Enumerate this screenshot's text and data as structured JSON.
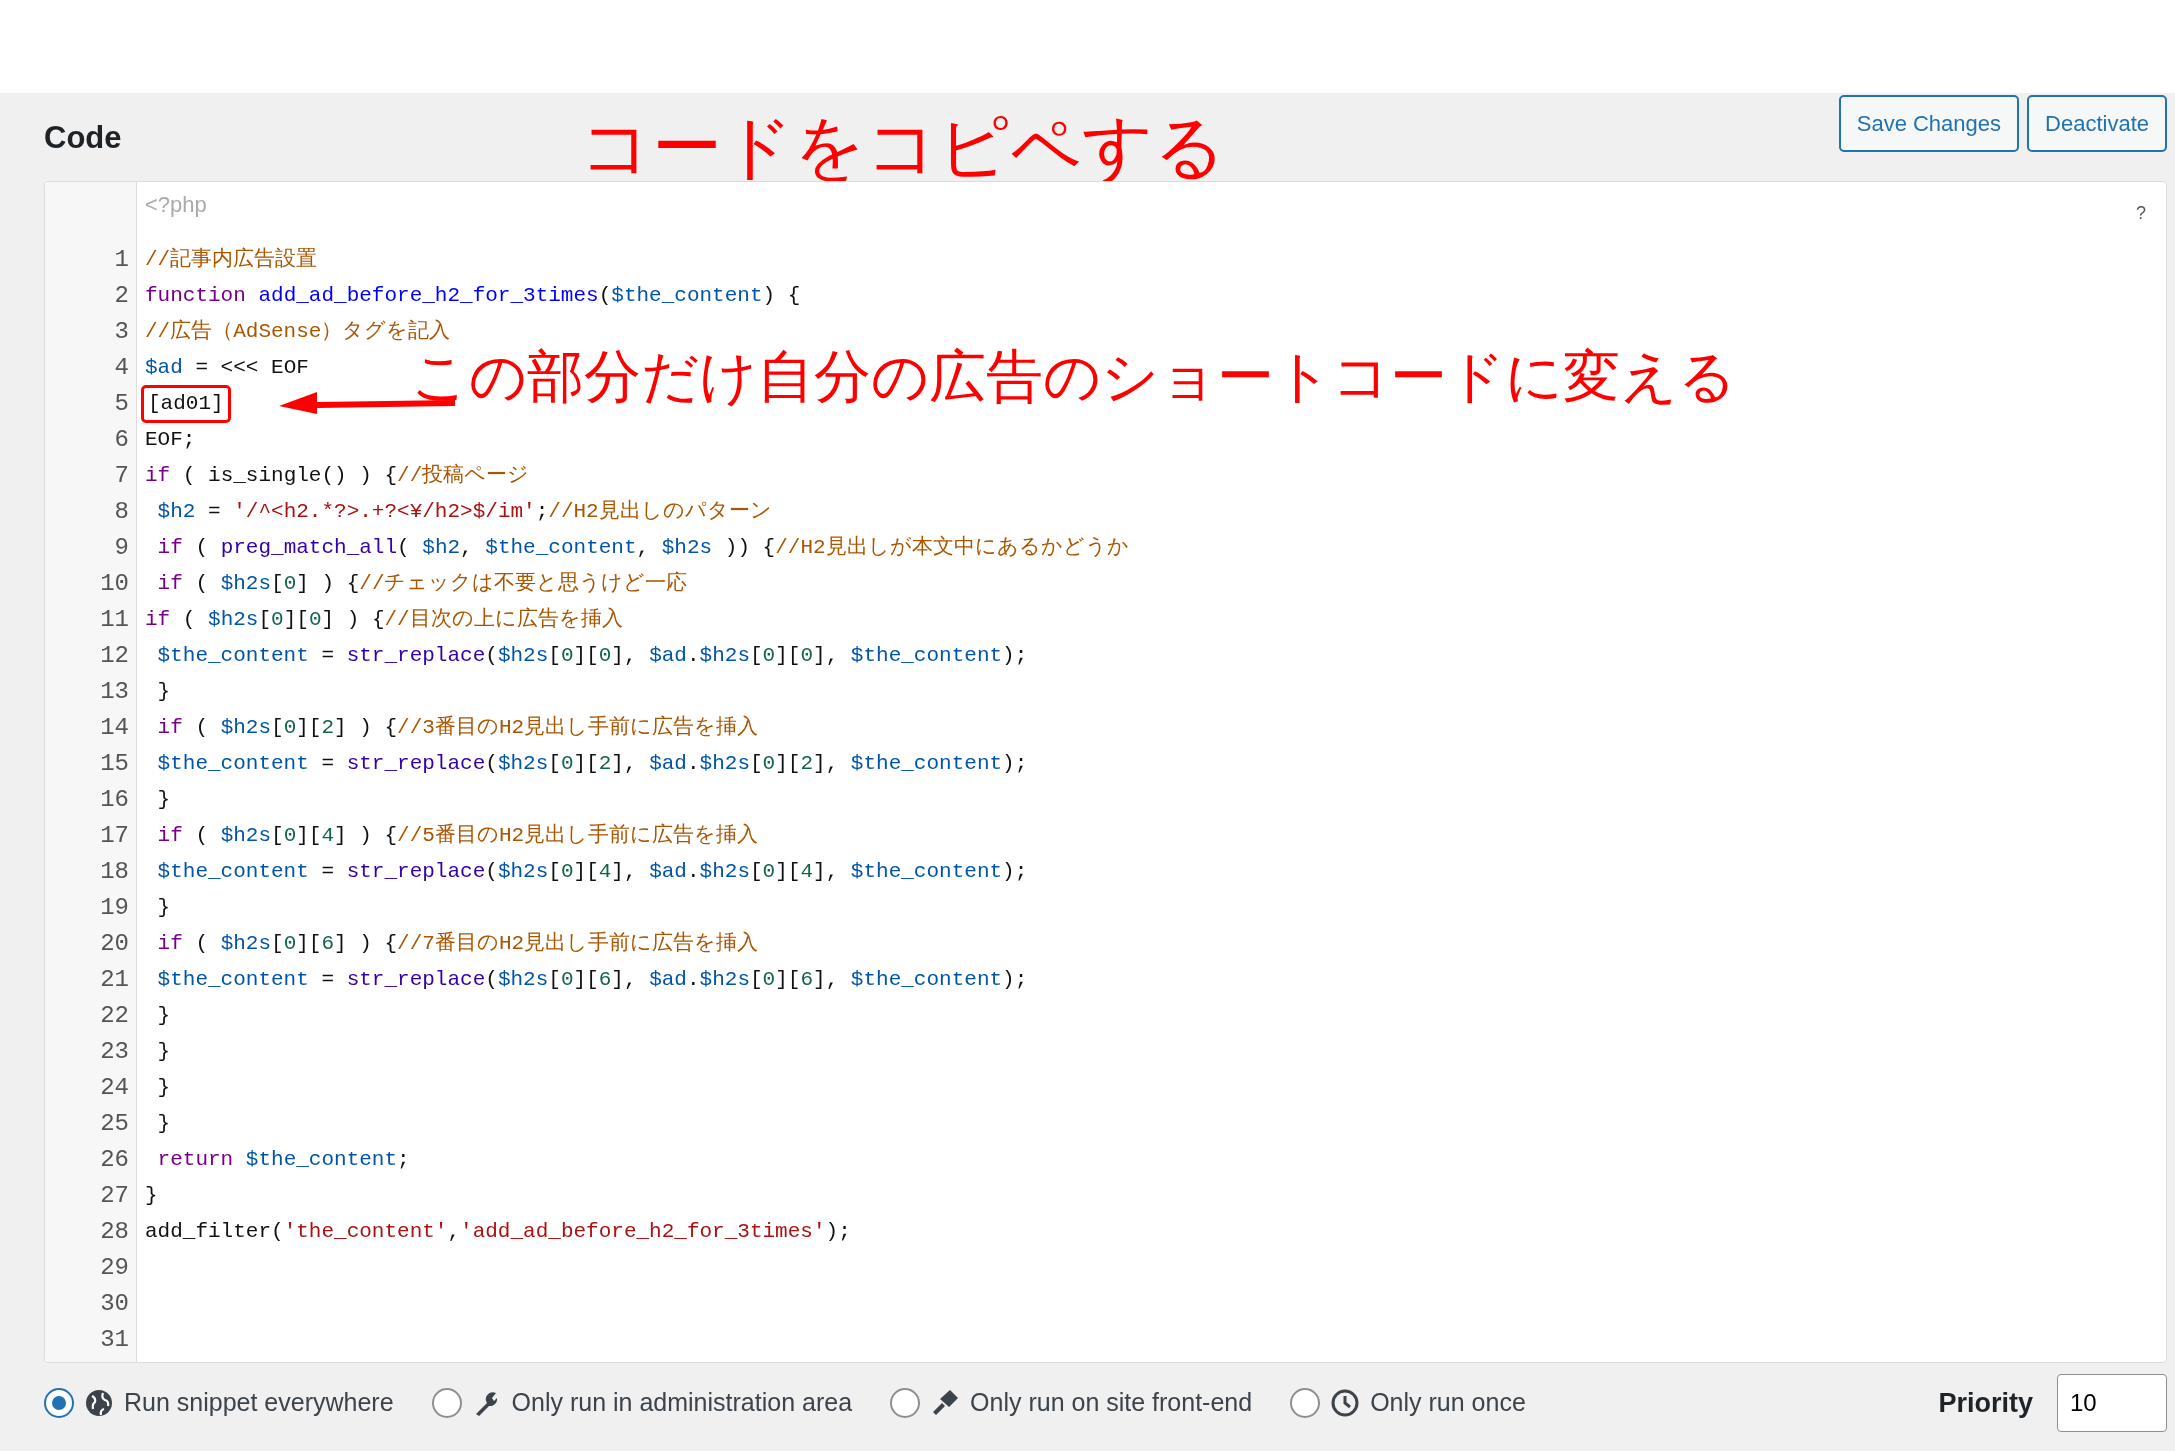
{
  "section_title": "Code",
  "buttons": [
    "Save Changes",
    "Deactivate"
  ],
  "annotations": [
    {
      "kind": "title",
      "text": "コードをコピペする"
    },
    {
      "kind": "callout",
      "text": "この部分だけ自分の広告のショートコードに変える"
    }
  ],
  "editor": {
    "opening_tag": "<?php",
    "help": "?",
    "lines": [
      {
        "number": "1",
        "highlighted": false,
        "tokens": [
          {
            "kind": "comment",
            "text": "//記事内広告設置"
          }
        ]
      },
      {
        "number": "2",
        "highlighted": false,
        "tokens": [
          {
            "kind": "keyword",
            "text": "function "
          },
          {
            "kind": "def",
            "text": "add_ad_before_h2_for_3times"
          },
          {
            "kind": "plain",
            "text": "("
          },
          {
            "kind": "variable",
            "text": "$the_content"
          },
          {
            "kind": "plain",
            "text": ") {"
          }
        ]
      },
      {
        "number": "3",
        "highlighted": false,
        "tokens": [
          {
            "kind": "comment",
            "text": "//広告（AdSense）タグを記入"
          }
        ]
      },
      {
        "number": "4",
        "highlighted": false,
        "tokens": [
          {
            "kind": "variable",
            "text": "$ad"
          },
          {
            "kind": "plain",
            "text": " = <<< EOF"
          }
        ]
      },
      {
        "number": "5",
        "highlighted": true,
        "tokens": [
          {
            "kind": "plain",
            "text": "[ad01]"
          }
        ]
      },
      {
        "number": "6",
        "highlighted": false,
        "tokens": [
          {
            "kind": "plain",
            "text": "EOF;"
          }
        ]
      },
      {
        "number": "7",
        "highlighted": false,
        "tokens": [
          {
            "kind": "keyword",
            "text": "if"
          },
          {
            "kind": "plain",
            "text": " ( is_single() ) {"
          },
          {
            "kind": "comment",
            "text": "//投稿ページ"
          }
        ]
      },
      {
        "number": "8",
        "highlighted": false,
        "tokens": [
          {
            "kind": "variable",
            "text": " $h2"
          },
          {
            "kind": "plain",
            "text": " = "
          },
          {
            "kind": "string",
            "text": "'/^<h2.*?>.+?<¥/h2>$/im'"
          },
          {
            "kind": "plain",
            "text": ";"
          },
          {
            "kind": "comment",
            "text": "//H2見出しのパターン"
          }
        ]
      },
      {
        "number": "9",
        "highlighted": false,
        "tokens": [
          {
            "kind": "keyword",
            "text": " if"
          },
          {
            "kind": "plain",
            "text": " ( "
          },
          {
            "kind": "builtin",
            "text": "preg_match_all"
          },
          {
            "kind": "plain",
            "text": "( "
          },
          {
            "kind": "variable",
            "text": "$h2"
          },
          {
            "kind": "plain",
            "text": ", "
          },
          {
            "kind": "variable",
            "text": "$the_content"
          },
          {
            "kind": "plain",
            "text": ", "
          },
          {
            "kind": "variable",
            "text": "$h2s"
          },
          {
            "kind": "plain",
            "text": " )) {"
          },
          {
            "kind": "comment",
            "text": "//H2見出しが本文中にあるかどうか"
          }
        ]
      },
      {
        "number": "10",
        "highlighted": false,
        "tokens": [
          {
            "kind": "keyword",
            "text": " if"
          },
          {
            "kind": "plain",
            "text": " ( "
          },
          {
            "kind": "variable",
            "text": "$h2s"
          },
          {
            "kind": "plain",
            "text": "["
          },
          {
            "kind": "number",
            "text": "0"
          },
          {
            "kind": "plain",
            "text": "] ) {"
          },
          {
            "kind": "comment",
            "text": "//チェックは不要と思うけど一応"
          }
        ]
      },
      {
        "number": "11",
        "highlighted": false,
        "tokens": [
          {
            "kind": "keyword",
            "text": "if"
          },
          {
            "kind": "plain",
            "text": " ( "
          },
          {
            "kind": "variable",
            "text": "$h2s"
          },
          {
            "kind": "plain",
            "text": "["
          },
          {
            "kind": "number",
            "text": "0"
          },
          {
            "kind": "plain",
            "text": "]["
          },
          {
            "kind": "number",
            "text": "0"
          },
          {
            "kind": "plain",
            "text": "] ) {"
          },
          {
            "kind": "comment",
            "text": "//目次の上に広告を挿入"
          }
        ]
      },
      {
        "number": "12",
        "highlighted": false,
        "tokens": [
          {
            "kind": "variable",
            "text": " $the_content"
          },
          {
            "kind": "plain",
            "text": " = "
          },
          {
            "kind": "builtin",
            "text": "str_replace"
          },
          {
            "kind": "plain",
            "text": "("
          },
          {
            "kind": "variable",
            "text": "$h2s"
          },
          {
            "kind": "plain",
            "text": "["
          },
          {
            "kind": "number",
            "text": "0"
          },
          {
            "kind": "plain",
            "text": "]["
          },
          {
            "kind": "number",
            "text": "0"
          },
          {
            "kind": "plain",
            "text": "], "
          },
          {
            "kind": "variable",
            "text": "$ad"
          },
          {
            "kind": "plain",
            "text": "."
          },
          {
            "kind": "variable",
            "text": "$h2s"
          },
          {
            "kind": "plain",
            "text": "["
          },
          {
            "kind": "number",
            "text": "0"
          },
          {
            "kind": "plain",
            "text": "]["
          },
          {
            "kind": "number",
            "text": "0"
          },
          {
            "kind": "plain",
            "text": "], "
          },
          {
            "kind": "variable",
            "text": "$the_content"
          },
          {
            "kind": "plain",
            "text": ");"
          }
        ]
      },
      {
        "number": "13",
        "highlighted": false,
        "tokens": [
          {
            "kind": "plain",
            "text": " }"
          }
        ]
      },
      {
        "number": "14",
        "highlighted": false,
        "tokens": [
          {
            "kind": "keyword",
            "text": " if"
          },
          {
            "kind": "plain",
            "text": " ( "
          },
          {
            "kind": "variable",
            "text": "$h2s"
          },
          {
            "kind": "plain",
            "text": "["
          },
          {
            "kind": "number",
            "text": "0"
          },
          {
            "kind": "plain",
            "text": "]["
          },
          {
            "kind": "number",
            "text": "2"
          },
          {
            "kind": "plain",
            "text": "] ) {"
          },
          {
            "kind": "comment",
            "text": "//3番目のH2見出し手前に広告を挿入"
          }
        ]
      },
      {
        "number": "15",
        "highlighted": false,
        "tokens": [
          {
            "kind": "variable",
            "text": " $the_content"
          },
          {
            "kind": "plain",
            "text": " = "
          },
          {
            "kind": "builtin",
            "text": "str_replace"
          },
          {
            "kind": "plain",
            "text": "("
          },
          {
            "kind": "variable",
            "text": "$h2s"
          },
          {
            "kind": "plain",
            "text": "["
          },
          {
            "kind": "number",
            "text": "0"
          },
          {
            "kind": "plain",
            "text": "]["
          },
          {
            "kind": "number",
            "text": "2"
          },
          {
            "kind": "plain",
            "text": "], "
          },
          {
            "kind": "variable",
            "text": "$ad"
          },
          {
            "kind": "plain",
            "text": "."
          },
          {
            "kind": "variable",
            "text": "$h2s"
          },
          {
            "kind": "plain",
            "text": "["
          },
          {
            "kind": "number",
            "text": "0"
          },
          {
            "kind": "plain",
            "text": "]["
          },
          {
            "kind": "number",
            "text": "2"
          },
          {
            "kind": "plain",
            "text": "], "
          },
          {
            "kind": "variable",
            "text": "$the_content"
          },
          {
            "kind": "plain",
            "text": ");"
          }
        ]
      },
      {
        "number": "16",
        "highlighted": false,
        "tokens": [
          {
            "kind": "plain",
            "text": " }"
          }
        ]
      },
      {
        "number": "17",
        "highlighted": false,
        "tokens": [
          {
            "kind": "keyword",
            "text": " if"
          },
          {
            "kind": "plain",
            "text": " ( "
          },
          {
            "kind": "variable",
            "text": "$h2s"
          },
          {
            "kind": "plain",
            "text": "["
          },
          {
            "kind": "number",
            "text": "0"
          },
          {
            "kind": "plain",
            "text": "]["
          },
          {
            "kind": "number",
            "text": "4"
          },
          {
            "kind": "plain",
            "text": "] ) {"
          },
          {
            "kind": "comment",
            "text": "//5番目のH2見出し手前に広告を挿入"
          }
        ]
      },
      {
        "number": "18",
        "highlighted": false,
        "tokens": [
          {
            "kind": "variable",
            "text": " $the_content"
          },
          {
            "kind": "plain",
            "text": " = "
          },
          {
            "kind": "builtin",
            "text": "str_replace"
          },
          {
            "kind": "plain",
            "text": "("
          },
          {
            "kind": "variable",
            "text": "$h2s"
          },
          {
            "kind": "plain",
            "text": "["
          },
          {
            "kind": "number",
            "text": "0"
          },
          {
            "kind": "plain",
            "text": "]["
          },
          {
            "kind": "number",
            "text": "4"
          },
          {
            "kind": "plain",
            "text": "], "
          },
          {
            "kind": "variable",
            "text": "$ad"
          },
          {
            "kind": "plain",
            "text": "."
          },
          {
            "kind": "variable",
            "text": "$h2s"
          },
          {
            "kind": "plain",
            "text": "["
          },
          {
            "kind": "number",
            "text": "0"
          },
          {
            "kind": "plain",
            "text": "]["
          },
          {
            "kind": "number",
            "text": "4"
          },
          {
            "kind": "plain",
            "text": "], "
          },
          {
            "kind": "variable",
            "text": "$the_content"
          },
          {
            "kind": "plain",
            "text": ");"
          }
        ]
      },
      {
        "number": "19",
        "highlighted": false,
        "tokens": [
          {
            "kind": "plain",
            "text": " }"
          }
        ]
      },
      {
        "number": "20",
        "highlighted": false,
        "tokens": [
          {
            "kind": "keyword",
            "text": " if"
          },
          {
            "kind": "plain",
            "text": " ( "
          },
          {
            "kind": "variable",
            "text": "$h2s"
          },
          {
            "kind": "plain",
            "text": "["
          },
          {
            "kind": "number",
            "text": "0"
          },
          {
            "kind": "plain",
            "text": "]["
          },
          {
            "kind": "number",
            "text": "6"
          },
          {
            "kind": "plain",
            "text": "] ) {"
          },
          {
            "kind": "comment",
            "text": "//7番目のH2見出し手前に広告を挿入"
          }
        ]
      },
      {
        "number": "21",
        "highlighted": false,
        "tokens": [
          {
            "kind": "variable",
            "text": " $the_content"
          },
          {
            "kind": "plain",
            "text": " = "
          },
          {
            "kind": "builtin",
            "text": "str_replace"
          },
          {
            "kind": "plain",
            "text": "("
          },
          {
            "kind": "variable",
            "text": "$h2s"
          },
          {
            "kind": "plain",
            "text": "["
          },
          {
            "kind": "number",
            "text": "0"
          },
          {
            "kind": "plain",
            "text": "]["
          },
          {
            "kind": "number",
            "text": "6"
          },
          {
            "kind": "plain",
            "text": "], "
          },
          {
            "kind": "variable",
            "text": "$ad"
          },
          {
            "kind": "plain",
            "text": "."
          },
          {
            "kind": "variable",
            "text": "$h2s"
          },
          {
            "kind": "plain",
            "text": "["
          },
          {
            "kind": "number",
            "text": "0"
          },
          {
            "kind": "plain",
            "text": "]["
          },
          {
            "kind": "number",
            "text": "6"
          },
          {
            "kind": "plain",
            "text": "], "
          },
          {
            "kind": "variable",
            "text": "$the_content"
          },
          {
            "kind": "plain",
            "text": ");"
          }
        ]
      },
      {
        "number": "22",
        "highlighted": false,
        "tokens": [
          {
            "kind": "plain",
            "text": " }"
          }
        ]
      },
      {
        "number": "23",
        "highlighted": false,
        "tokens": [
          {
            "kind": "plain",
            "text": " }"
          }
        ]
      },
      {
        "number": "24",
        "highlighted": false,
        "tokens": [
          {
            "kind": "plain",
            "text": " }"
          }
        ]
      },
      {
        "number": "25",
        "highlighted": false,
        "tokens": [
          {
            "kind": "plain",
            "text": " }"
          }
        ]
      },
      {
        "number": "26",
        "highlighted": false,
        "tokens": [
          {
            "kind": "keyword",
            "text": " return"
          },
          {
            "kind": "variable",
            "text": " $the_content"
          },
          {
            "kind": "plain",
            "text": ";"
          }
        ]
      },
      {
        "number": "27",
        "highlighted": false,
        "tokens": [
          {
            "kind": "plain",
            "text": "}"
          }
        ]
      },
      {
        "number": "28",
        "highlighted": false,
        "tokens": [
          {
            "kind": "plain",
            "text": "add_filter("
          },
          {
            "kind": "string",
            "text": "'the_content'"
          },
          {
            "kind": "plain",
            "text": ","
          },
          {
            "kind": "string",
            "text": "'add_ad_before_h2_for_3times'"
          },
          {
            "kind": "plain",
            "text": ");"
          }
        ]
      },
      {
        "number": "29",
        "highlighted": false
      },
      {
        "number": "30",
        "highlighted": false
      },
      {
        "number": "31",
        "highlighted": false
      }
    ]
  },
  "scope_options": [
    {
      "label": "Run snippet everywhere",
      "selected": true
    },
    {
      "label": "Only run in administration area",
      "selected": false
    },
    {
      "label": "Only run on site front-end",
      "selected": false
    },
    {
      "label": "Only run once",
      "selected": false
    }
  ],
  "priority": {
    "label": "Priority",
    "value": "10"
  }
}
